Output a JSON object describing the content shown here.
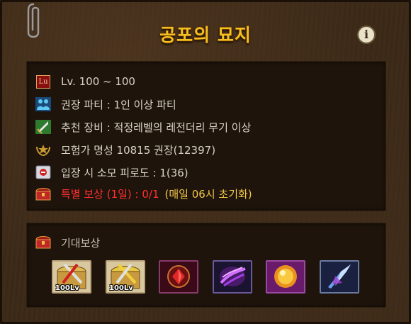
{
  "dungeon": {
    "title": "공포의 묘지",
    "info_icon": "i"
  },
  "conditions": {
    "level_icon_text": "Lu",
    "level": "Lv. 100 ~ 100",
    "party": "권장 파티 : 1인 이상 파티",
    "equipment": "추천 장비 : 적정레벨의 레전더리 무기 이상",
    "fame": "모험가 명성 10815 권장(12397)",
    "fatigue": "입장 시 소모 피로도 : 1(36)",
    "special_reward": "특별 보상 (1일) : 0/1",
    "reset_note": "(매일 06시 초기화)"
  },
  "rewards": {
    "label": "기대보상",
    "items": [
      {
        "icon": "weapon-box-icon",
        "level": "100Lv"
      },
      {
        "icon": "weapon-box-icon",
        "level": "100Lv"
      },
      {
        "icon": "red-gem-icon",
        "level": ""
      },
      {
        "icon": "purple-orb-icon",
        "level": ""
      },
      {
        "icon": "golden-orb-icon",
        "level": ""
      },
      {
        "icon": "blue-crystal-icon",
        "level": ""
      }
    ]
  },
  "colors": {
    "title": "#f4c020",
    "text": "#d8d2c4",
    "special": "#ff3030",
    "note": "#f2c84a"
  }
}
